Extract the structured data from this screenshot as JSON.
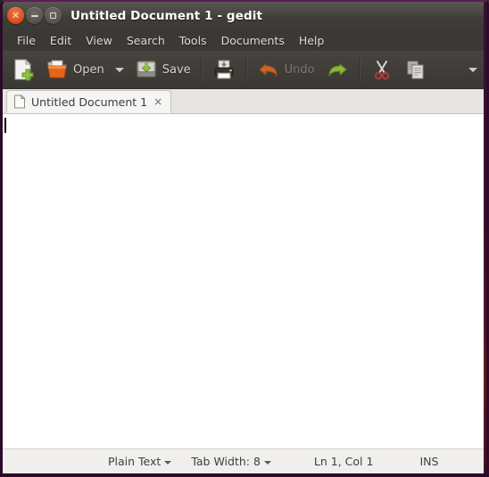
{
  "window": {
    "title": "Untitled Document 1 - gedit",
    "controls": [
      {
        "name": "close-button",
        "glyph": "×"
      },
      {
        "name": "minimize-button",
        "glyph": "–"
      },
      {
        "name": "maximize-button",
        "glyph": "□"
      }
    ],
    "colors": {
      "titlebar": "#484540",
      "border": "#2b0a2b",
      "toolbar": "#403d39",
      "editor_bg": "#ffffff",
      "statusbar_bg": "#f0efed",
      "close_button": "#da4b16",
      "accent_green": "#8fbc3f",
      "accent_orange": "#e5611d"
    }
  },
  "menubar": {
    "items": [
      {
        "label": "File"
      },
      {
        "label": "Edit"
      },
      {
        "label": "View"
      },
      {
        "label": "Search"
      },
      {
        "label": "Tools"
      },
      {
        "label": "Documents"
      },
      {
        "label": "Help"
      }
    ]
  },
  "toolbar": {
    "new_label": "",
    "open_label": "Open",
    "save_label": "Save",
    "print_label": "",
    "undo_label": "Undo",
    "redo_label": "",
    "cut_label": "",
    "copy_label": "",
    "overflow_label": "",
    "undo_enabled": false
  },
  "tabs": [
    {
      "label": "Untitled Document 1",
      "close_glyph": "×",
      "active": true
    }
  ],
  "editor": {
    "content": "",
    "caret_visible": true
  },
  "statusbar": {
    "language": "Plain Text",
    "tab_width": "Tab Width: 8",
    "position": "Ln 1, Col 1",
    "insert_mode": "INS"
  }
}
